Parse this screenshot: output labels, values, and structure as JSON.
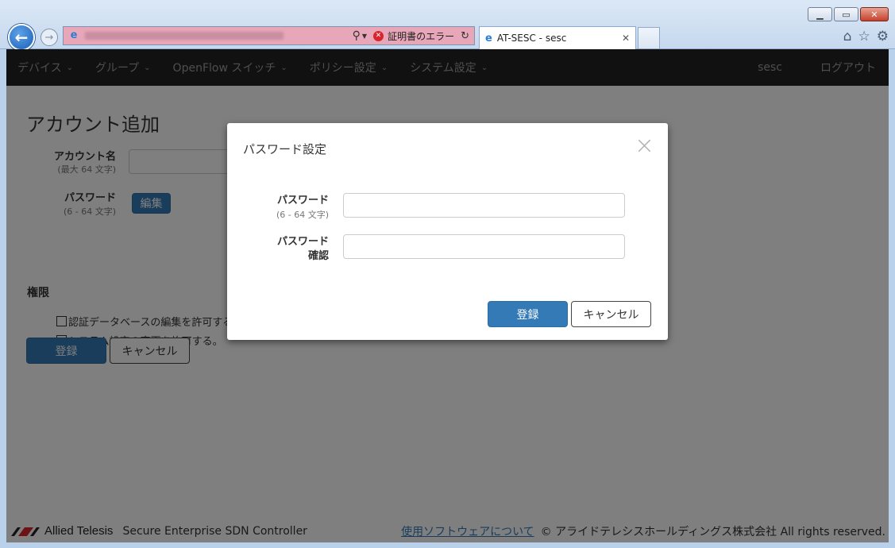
{
  "browser": {
    "cert_error": "証明書のエラー",
    "tab_title": "AT-SESC - sesc"
  },
  "navbar": {
    "items": [
      {
        "label": "デバイス"
      },
      {
        "label": "グループ"
      },
      {
        "label": "OpenFlow スイッチ"
      },
      {
        "label": "ポリシー設定"
      },
      {
        "label": "システム設定"
      }
    ],
    "user": "sesc",
    "logout": "ログアウト"
  },
  "page": {
    "title": "アカウント追加",
    "account_label": "アカウント名",
    "account_hint": "(最大 64 文字)",
    "password_label": "パスワード",
    "password_hint": "(6 - 64 文字)",
    "edit_button": "編集",
    "permissions_title": "権限",
    "perm_db": "認証データベースの編集を許可する",
    "perm_sys": "システム設定の変更を許可する。",
    "register_button": "登録",
    "cancel_button": "キャンセル"
  },
  "footer": {
    "logo_text": "Allied Telesis",
    "product": "Secure Enterprise SDN Controller",
    "link": "使用ソフトウェアについて",
    "copyright": "© アライドテレシスホールディングス株式会社 All rights reserved."
  },
  "modal": {
    "title": "パスワード設定",
    "password_label": "パスワード",
    "password_hint": "(6 - 64 文字)",
    "confirm_label_1": "パスワード",
    "confirm_label_2": "確認",
    "password_value": "",
    "confirm_value": "",
    "register_button": "登録",
    "cancel_button": "キャンセル"
  },
  "colors": {
    "primary": "#337ab7",
    "navbar_bg": "#222222"
  },
  "icons": {
    "back": "arrow-left-icon",
    "forward": "arrow-right-icon",
    "home": "home-icon",
    "favorites": "star-icon",
    "settings": "gear-icon"
  }
}
